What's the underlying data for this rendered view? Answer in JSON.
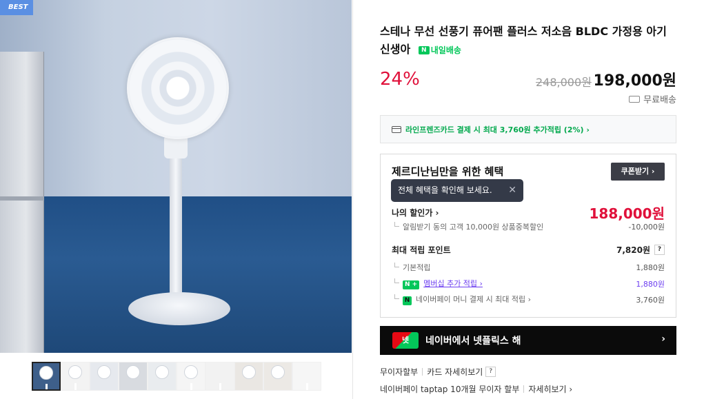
{
  "gallery": {
    "badge": "BEST",
    "thumb_count": 10
  },
  "product": {
    "title": "스테나 무선 선풍기 퓨어팬 플러스 저소음 BLDC 가정용 아기 신생아",
    "delivery_badge": "내일배송",
    "delivery_badge_icon": "N",
    "discount_rate": "24%",
    "original_price": "248,000원",
    "sale_price": "198,000원",
    "shipping": "무료배송"
  },
  "card_promo": {
    "text": "라인프렌즈카드 결제 시 최대 3,760원 추가적립 (2%) ›"
  },
  "benefits": {
    "title": "제르디난님만을 위한 혜택",
    "coupon_button": "쿠폰받기 ›",
    "tooltip": "전체 혜택을 확인해 보세요.",
    "tooltip_close": "✕",
    "my_price_label": "나의 할인가 ›",
    "my_price_value": "188,000원",
    "alarm_label": "알림받기 동의 고객 10,000원 상품중복할인",
    "alarm_value": "-10,000원",
    "points_label": "최대 적립 포인트",
    "points_value": "7,820원",
    "points_help": "?",
    "basic_label": "기본적립",
    "basic_value": "1,880원",
    "membership_badge": "N +",
    "membership_label": "멤버십 추가 적립 ›",
    "membership_value": "1,880원",
    "npay_badge": "N",
    "npay_label": "네이버페이 머니 결제 시 최대 적립 ›",
    "npay_value": "3,760원"
  },
  "netflix": {
    "logo": "넷",
    "text": "네이버에서 넷플릭스 해",
    "arrow": "›"
  },
  "installment": {
    "no_interest": "무이자할부",
    "card_detail": "카드 자세히보기",
    "help": "?",
    "npay_taptap": "네이버페이 taptap 10개월 무이자 할부",
    "detail": "자세히보기 ›"
  },
  "colors": {
    "accent_red": "#e0103a",
    "naver_green": "#03c75a",
    "membership_purple": "#6b3df0"
  }
}
